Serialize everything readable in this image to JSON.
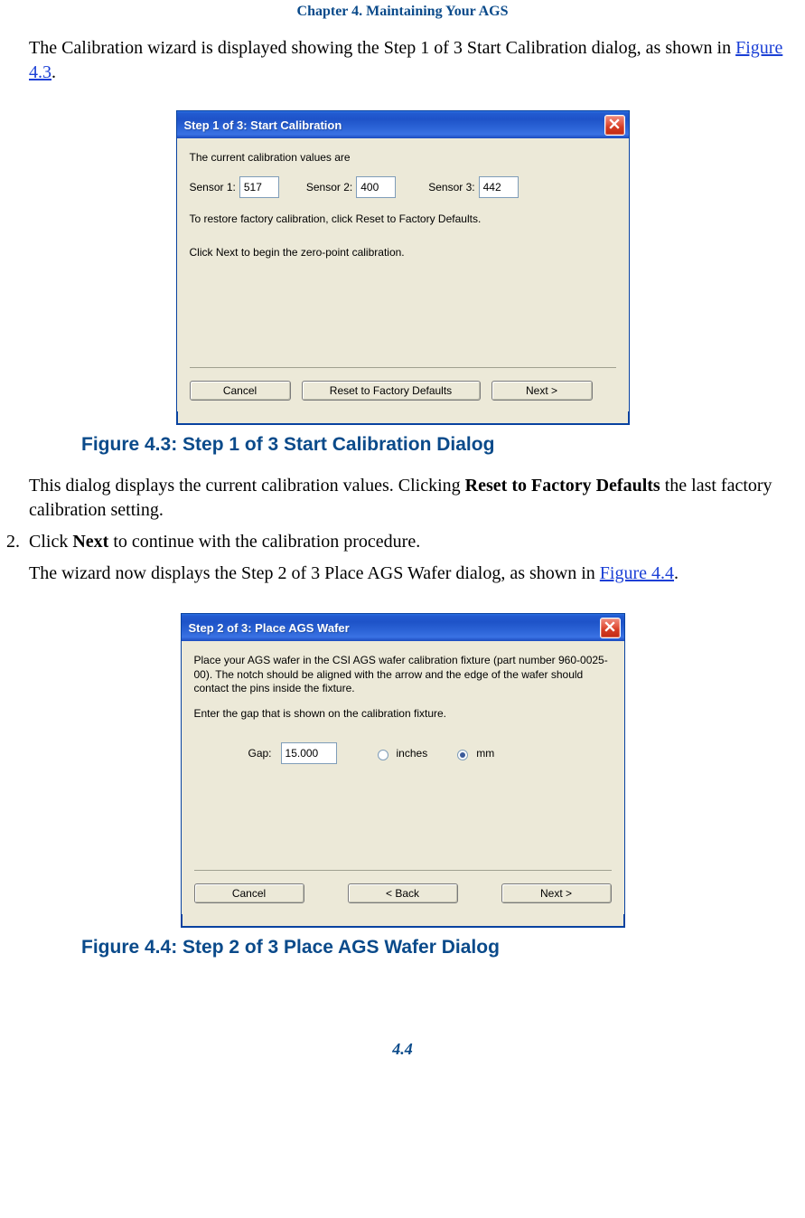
{
  "header": {
    "chapter": "Chapter 4. Maintaining Your AGS"
  },
  "intro": {
    "text_before": "The Calibration wizard is displayed showing the Step 1 of 3 Start Calibration dialog, as shown in ",
    "link": "Figure 4.3",
    "text_after": "."
  },
  "dialog1": {
    "title": "Step 1 of 3: Start Calibration",
    "line1": "The current calibration values are",
    "sensor1_label": "Sensor 1:",
    "sensor1_value": "517",
    "sensor2_label": "Sensor 2:",
    "sensor2_value": "400",
    "sensor3_label": "Sensor 3:",
    "sensor3_value": "442",
    "line2": "To restore factory calibration, click Reset to Factory Defaults.",
    "line3": "Click Next to begin the zero-point calibration.",
    "cancel": "Cancel",
    "reset": "Reset to Factory Defaults",
    "next": "Next >"
  },
  "caption1": "Figure 4.3: Step 1 of 3 Start Calibration Dialog",
  "after1": {
    "p1_a": "This dialog displays the current calibration values. Clicking ",
    "p1_b": "Reset to Factory Defaults",
    "p1_c": " the last factory calibration setting.",
    "step_num": "2.",
    "step_a": "Click ",
    "step_b": "Next",
    "step_c": " to continue with the calibration procedure.",
    "p2_a": "The wizard now displays the Step 2 of 3 Place AGS Wafer dialog, as shown in ",
    "p2_link": "Figure 4.4",
    "p2_b": "."
  },
  "dialog2": {
    "title": "Step 2 of 3: Place AGS Wafer",
    "para1": "Place your AGS wafer in the CSI AGS wafer calibration fixture (part number 960-0025-00).  The notch should be aligned with the arrow and the edge of the wafer should contact the pins inside the fixture.",
    "para2": "Enter the gap that is shown on the calibration fixture.",
    "gap_label": "Gap:",
    "gap_value": "15.000",
    "unit_inches": "inches",
    "unit_mm": "mm",
    "cancel": "Cancel",
    "back": "< Back",
    "next": "Next >"
  },
  "caption2": "Figure 4.4: Step 2 of 3 Place AGS Wafer Dialog",
  "page_number": "4.4"
}
